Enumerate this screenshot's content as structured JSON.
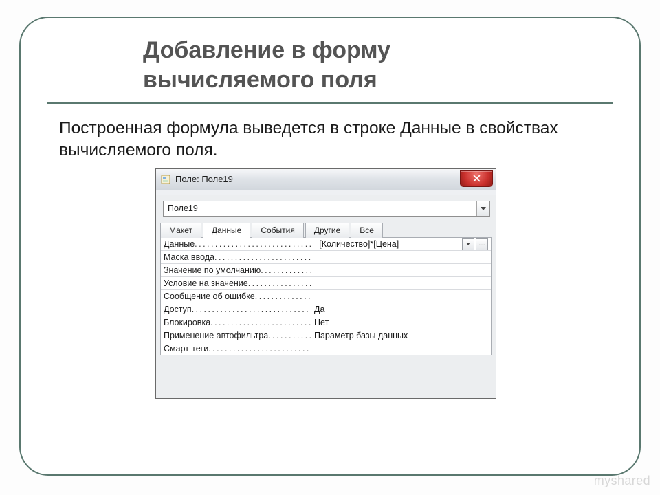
{
  "heading": {
    "line1": "Добавление в форму",
    "line2": "вычисляемого поля"
  },
  "description": "Построенная формула выведется в строке Данные в свойствах вычисляемого поля.",
  "window": {
    "title": "Поле: Поле19",
    "selector_value": "Поле19",
    "tabs": [
      "Макет",
      "Данные",
      "События",
      "Другие",
      "Все"
    ],
    "active_tab_index": 1,
    "rows": [
      {
        "label": "Данные",
        "value": "=[Количество]*[Цена]",
        "has_dropdown": true,
        "has_builder": true
      },
      {
        "label": "Маска ввода",
        "value": ""
      },
      {
        "label": "Значение по умолчанию",
        "value": ""
      },
      {
        "label": "Условие на значение",
        "value": ""
      },
      {
        "label": "Сообщение об ошибке",
        "value": ""
      },
      {
        "label": "Доступ",
        "value": "Да"
      },
      {
        "label": "Блокировка",
        "value": "Нет"
      },
      {
        "label": "Применение автофильтра",
        "value": "Параметр базы данных"
      },
      {
        "label": "Смарт-теги",
        "value": ""
      }
    ]
  },
  "watermark": "myshared"
}
